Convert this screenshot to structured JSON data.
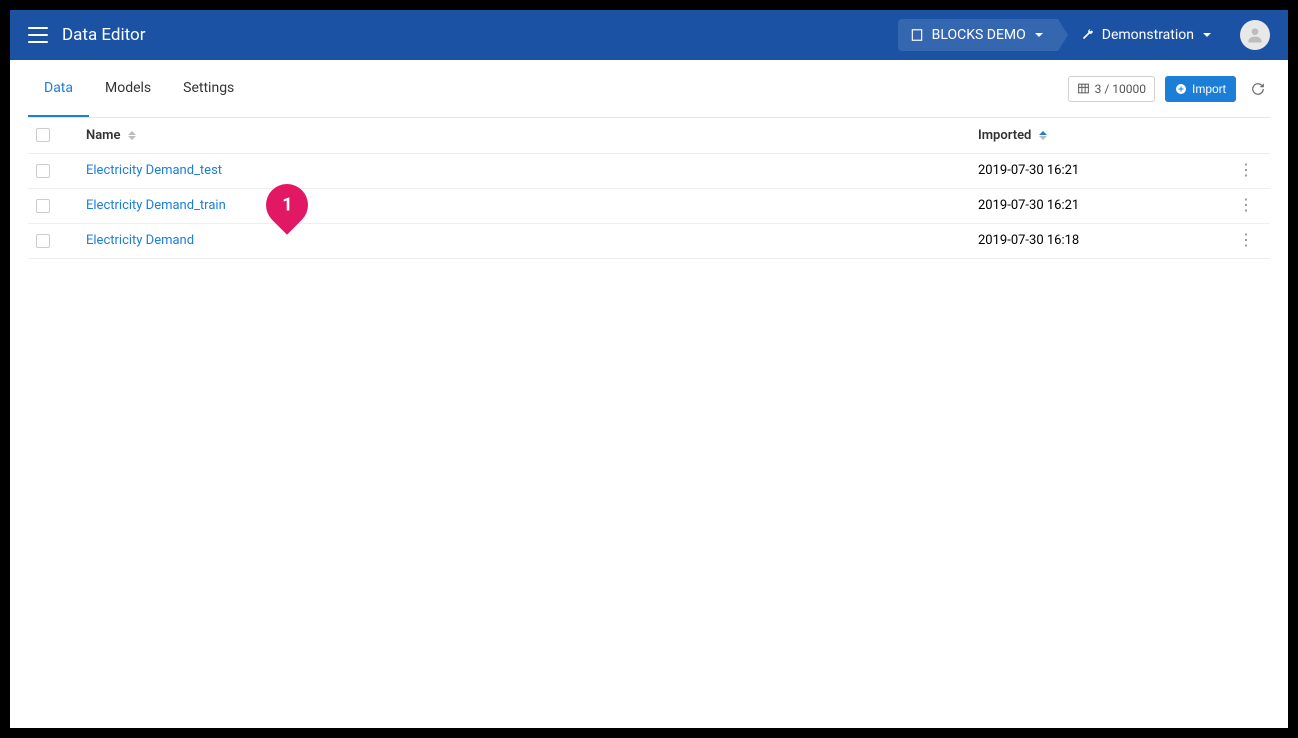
{
  "header": {
    "title": "Data Editor",
    "crumb1": "BLOCKS DEMO",
    "crumb2": "Demonstration"
  },
  "tabs": {
    "items": [
      {
        "label": "Data",
        "active": true
      },
      {
        "label": "Models",
        "active": false
      },
      {
        "label": "Settings",
        "active": false
      }
    ]
  },
  "toolbar": {
    "count": "3 / 10000",
    "import_label": "Import"
  },
  "columns": {
    "name": "Name",
    "imported": "Imported"
  },
  "rows": [
    {
      "name": "Electricity Demand_test",
      "imported": "2019-07-30 16:21"
    },
    {
      "name": "Electricity Demand_train",
      "imported": "2019-07-30 16:21"
    },
    {
      "name": "Electricity Demand",
      "imported": "2019-07-30 16:18"
    }
  ],
  "balloon": {
    "row_index": 1,
    "label": "1"
  }
}
